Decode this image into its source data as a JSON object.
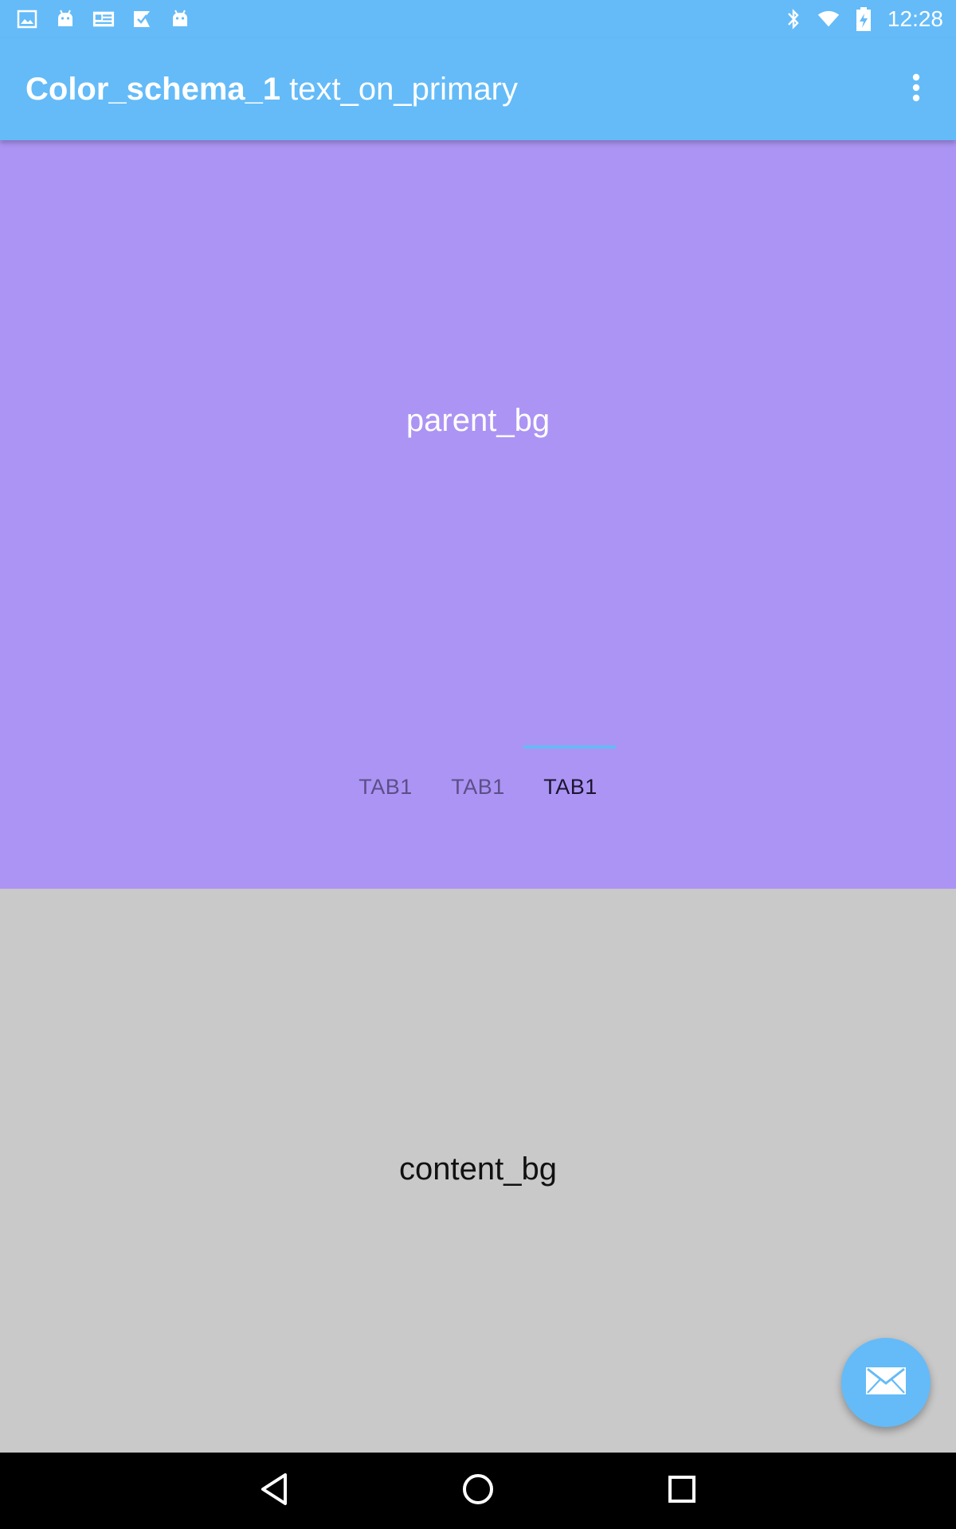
{
  "status_bar": {
    "time": "12:28",
    "left_icons": [
      "image-icon",
      "android-icon",
      "news-icon",
      "play-store-icon",
      "android-icon"
    ],
    "right_icons": [
      "bluetooth-icon",
      "wifi-icon",
      "battery-charging-icon"
    ]
  },
  "app_bar": {
    "title_bold": "Color_schema_1",
    "title_regular": "text_on_primary",
    "overflow_icon": "more-vert-icon"
  },
  "parent": {
    "label": "parent_bg"
  },
  "tabs": {
    "items": [
      {
        "label": "TAB1",
        "selected": false
      },
      {
        "label": "TAB1",
        "selected": false
      },
      {
        "label": "TAB1",
        "selected": true
      }
    ]
  },
  "content": {
    "label": "content_bg"
  },
  "fab": {
    "icon": "mail-icon"
  },
  "nav_bar": {
    "buttons": [
      "back-icon",
      "home-icon",
      "recents-icon"
    ]
  },
  "colors": {
    "primary": "#64bbf8",
    "parent_bg": "#ac94f4",
    "content_bg": "#c9c9c9",
    "text_on_primary": "#ffffff",
    "tab_selected": "#1b1530",
    "tab_unselected": "#5c4f88",
    "nav_bar": "#000000"
  }
}
